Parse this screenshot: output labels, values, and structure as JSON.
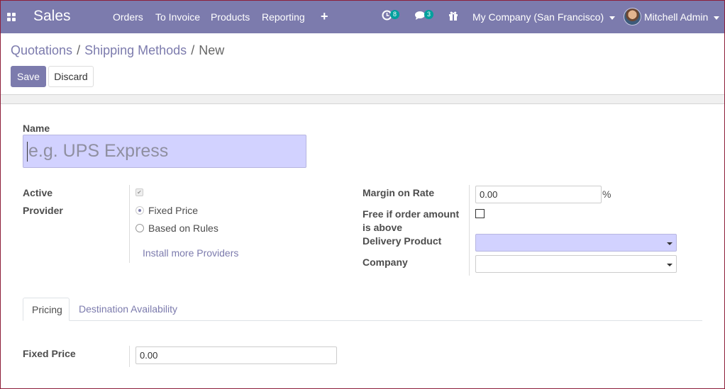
{
  "navbar": {
    "app_name": "Sales",
    "menu": [
      "Orders",
      "To Invoice",
      "Products",
      "Reporting"
    ],
    "plus": "+",
    "activity_badge": "8",
    "messages_badge": "3",
    "company": "My Company (San Francisco)",
    "user": "Mitchell Admin"
  },
  "breadcrumb": {
    "items": [
      "Quotations",
      "Shipping Methods"
    ],
    "current": "New",
    "separator": "/"
  },
  "buttons": {
    "save": "Save",
    "discard": "Discard"
  },
  "form": {
    "name_label": "Name",
    "name_placeholder": "e.g. UPS Express",
    "active_label": "Active",
    "active_checked": true,
    "provider_label": "Provider",
    "provider_options": [
      "Fixed Price",
      "Based on Rules"
    ],
    "provider_selected": "Fixed Price",
    "install_link": "Install more Providers",
    "margin_label": "Margin on Rate",
    "margin_value": "0.00",
    "margin_unit": "%",
    "free_label_1": "Free if order amount",
    "free_label_2": "is above",
    "free_checked": false,
    "delivery_product_label": "Delivery Product",
    "delivery_product_value": "",
    "company_label": "Company",
    "company_value": ""
  },
  "tabs": [
    "Pricing",
    "Destination Availability"
  ],
  "pricing": {
    "fixed_price_label": "Fixed Price",
    "fixed_price_value": "0.00"
  },
  "colors": {
    "brand": "#7c7bad",
    "required_bg": "#d2d2ff",
    "badge": "#00a09d"
  }
}
